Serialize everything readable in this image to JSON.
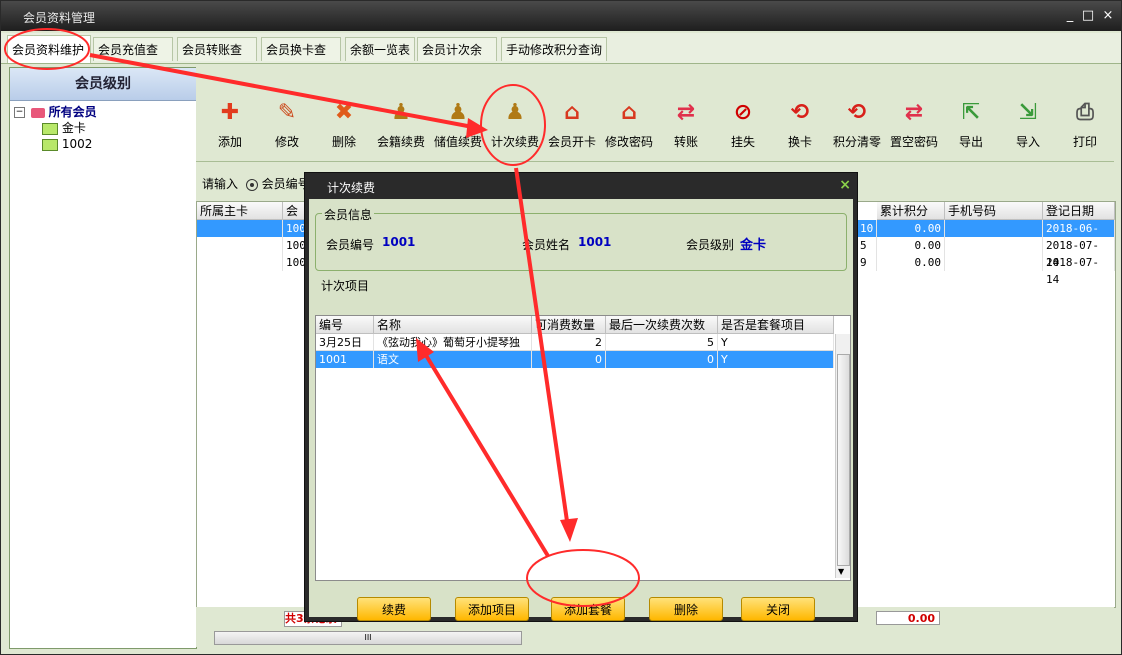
{
  "window": {
    "title": "会员资料管理",
    "controls": [
      "_",
      "□",
      "×"
    ]
  },
  "tabs": [
    "会员资料维护",
    "会员充值查询",
    "会员转账查询",
    "会员换卡查询",
    "余额一览表",
    "会员计次余额",
    "手动修改积分查询"
  ],
  "sidebar": {
    "title": "会员级别",
    "tree": [
      {
        "label": "所有会员",
        "level": 0,
        "bold": true
      },
      {
        "label": "金卡",
        "level": 1
      },
      {
        "label": "1002",
        "level": 1
      }
    ]
  },
  "toolbar": [
    {
      "label": "添加",
      "icon": "plus-icon",
      "color": "#e23b1e"
    },
    {
      "label": "修改",
      "icon": "wrench-icon",
      "color": "#cc4b1e"
    },
    {
      "label": "删除",
      "icon": "x-icon",
      "color": "#e05a1a"
    },
    {
      "label": "会籍续费",
      "icon": "stamp-icon",
      "color": "#b07a16"
    },
    {
      "label": "储值续费",
      "icon": "stamp-icon",
      "color": "#b07a16"
    },
    {
      "label": "计次续费",
      "icon": "stamp-icon",
      "color": "#b07a16"
    },
    {
      "label": "会员开卡",
      "icon": "house-icon",
      "color": "#d8381f"
    },
    {
      "label": "修改密码",
      "icon": "house-icon",
      "color": "#d8381f"
    },
    {
      "label": "转账",
      "icon": "arrows-icon",
      "color": "#e0304c"
    },
    {
      "label": "挂失",
      "icon": "ban-icon",
      "color": "#d00000"
    },
    {
      "label": "换卡",
      "icon": "refresh-icon",
      "color": "#d8201a"
    },
    {
      "label": "积分清零",
      "icon": "refresh-icon",
      "color": "#d8201a"
    },
    {
      "label": "置空密码",
      "icon": "arrows-icon",
      "color": "#e0304c"
    },
    {
      "label": "导出",
      "icon": "export-icon",
      "color": "#3a9a3a"
    },
    {
      "label": "导入",
      "icon": "import-icon",
      "color": "#3a9a3a"
    },
    {
      "label": "打印",
      "icon": "printer-icon",
      "color": "#555555"
    }
  ],
  "search": {
    "label": "请输入",
    "radio": "会员编号"
  },
  "grid": {
    "headers": {
      "left": [
        "所属主卡",
        "会员"
      ],
      "right": [
        "累计积分",
        "手机号码",
        "登记日期"
      ]
    },
    "rows": [
      {
        "card": "100",
        "count": "10",
        "points": "0.00",
        "phone": "",
        "date": "2018-06-29",
        "selected": true
      },
      {
        "card": "1002",
        "count": "5",
        "points": "0.00",
        "phone": "",
        "date": "2018-07-14",
        "selected": false
      },
      {
        "card": "1003",
        "count": "9",
        "points": "0.00",
        "phone": "",
        "date": "2018-07-14",
        "selected": false
      }
    ]
  },
  "footer": {
    "records": "共3条记录",
    "total": "0.00",
    "scroll_mark": "III"
  },
  "dialog": {
    "title": "计次续费",
    "close": "×",
    "info_legend": "会员信息",
    "member_no_label": "会员编号",
    "member_no": "1001",
    "member_name_label": "会员姓名",
    "member_name": "1001",
    "member_level_label": "会员级别",
    "member_level": "金卡",
    "items_legend": "计次项目",
    "columns": [
      "编号",
      "名称",
      "可消费数量",
      "最后一次续费次数",
      "是否是套餐项目"
    ],
    "rows": [
      {
        "no": "3月25日",
        "name": "《弦动我心》葡萄牙小提琴独",
        "qty": "2",
        "last": "5",
        "pkg": "Y",
        "selected": false
      },
      {
        "no": "1001",
        "name": "语文",
        "qty": "0",
        "last": "0",
        "pkg": "Y",
        "selected": true
      }
    ],
    "buttons": [
      "续费",
      "添加项目",
      "添加套餐",
      "删除",
      "关闭"
    ]
  },
  "colors": {
    "accent_selected": "#3399ff",
    "annotation": "#ff2b2b",
    "button_gold": "#ffc21a"
  }
}
